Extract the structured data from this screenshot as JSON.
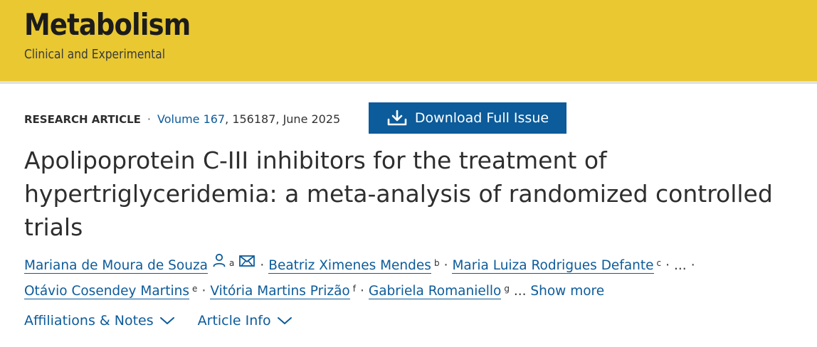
{
  "journal": {
    "title": "Metabolism",
    "subtitle": "Clinical and Experimental"
  },
  "meta": {
    "article_type": "RESEARCH ARTICLE",
    "separator": "·",
    "volume_label": "Volume 167",
    "details": ", 156187, June 2025"
  },
  "download_button": {
    "label": "Download Full Issue",
    "icon": "download-icon"
  },
  "article": {
    "title": "Apolipoprotein C-III inhibitors for the treatment of hypertriglyceridemia: a meta-analysis of randomized controlled trials"
  },
  "authors": {
    "list": [
      {
        "name": "Mariana de Moura de Souza",
        "sup": "a"
      },
      {
        "name": "Beatriz Ximenes Mendes",
        "sup": "b"
      },
      {
        "name": "Maria Luiza Rodrigues Defante",
        "sup": "c"
      },
      {
        "name": "Otávio Cosendey Martins",
        "sup": "e"
      },
      {
        "name": "Vitória Martins Prizão",
        "sup": "f"
      },
      {
        "name": "Gabriela Romaniello",
        "sup": "g"
      }
    ],
    "separator": "·",
    "ellipsis": "...",
    "show_more": "Show more",
    "icons": [
      "person-icon",
      "mail-icon"
    ]
  },
  "toggles": {
    "affiliations_label": "Affiliations & Notes",
    "article_info_label": "Article Info"
  },
  "colors": {
    "banner": "#e9c832",
    "link": "#0c5b9a",
    "button": "#0c5b9a"
  }
}
